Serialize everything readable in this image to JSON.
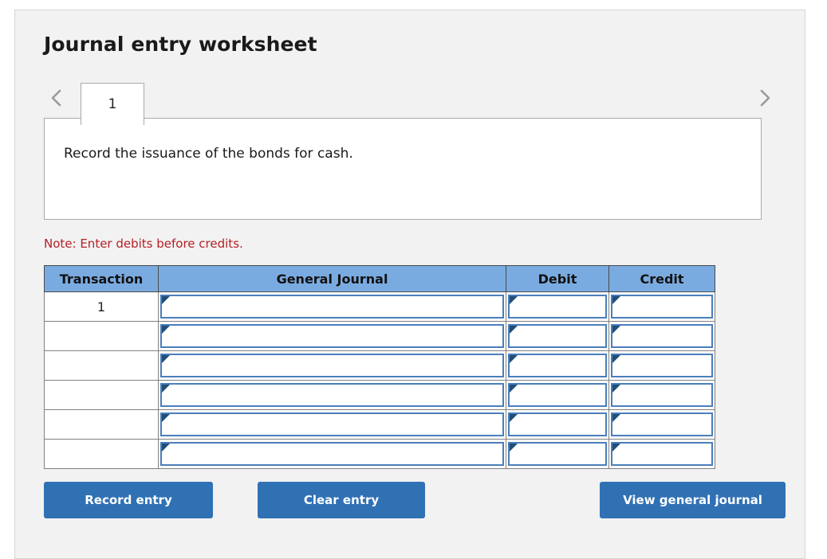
{
  "page": {
    "title": "Journal entry worksheet"
  },
  "tabs": {
    "prev_arrow_icon": "chevron-left-icon",
    "next_arrow_icon": "chevron-right-icon",
    "items": [
      {
        "label": "1",
        "active": true
      }
    ]
  },
  "instruction": {
    "text": "Record the issuance of the bonds for cash."
  },
  "note": {
    "text": "Note: Enter debits before credits."
  },
  "table": {
    "headers": [
      "Transaction",
      "General Journal",
      "Debit",
      "Credit"
    ],
    "rows": [
      {
        "transaction": "1",
        "general_journal": "",
        "debit": "",
        "credit": ""
      },
      {
        "transaction": "",
        "general_journal": "",
        "debit": "",
        "credit": ""
      },
      {
        "transaction": "",
        "general_journal": "",
        "debit": "",
        "credit": ""
      },
      {
        "transaction": "",
        "general_journal": "",
        "debit": "",
        "credit": ""
      },
      {
        "transaction": "",
        "general_journal": "",
        "debit": "",
        "credit": ""
      },
      {
        "transaction": "",
        "general_journal": "",
        "debit": "",
        "credit": ""
      }
    ]
  },
  "buttons": {
    "record_entry": "Record entry",
    "clear_entry": "Clear entry",
    "view_general_journal": "View general journal"
  },
  "colors": {
    "card_background": "#f2f2f2",
    "table_header_blue": "#7aabe0",
    "input_border_blue": "#4a7ebb",
    "input_marker_blue": "#1f4e79",
    "button_blue": "#3071b4",
    "note_red": "#b52025",
    "panel_white": "#ffffff"
  }
}
